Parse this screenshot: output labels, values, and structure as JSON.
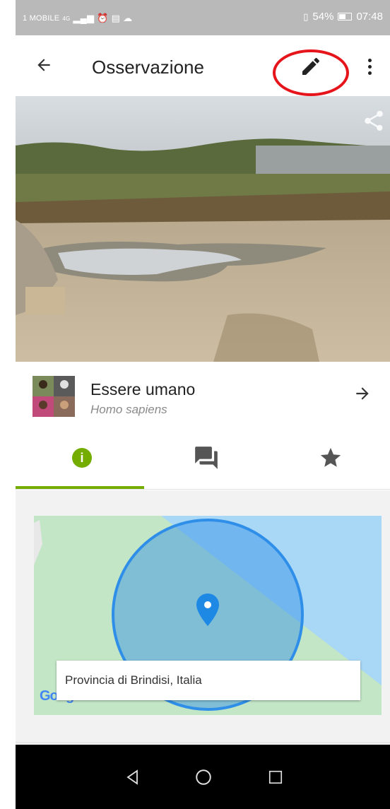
{
  "status_bar": {
    "carrier": "1 MOBILE",
    "network": "4G",
    "battery": "54%",
    "time": "07:48"
  },
  "app_bar": {
    "title": "Osservazione",
    "back_icon": "arrow-left-icon",
    "edit_icon": "pencil-icon",
    "menu_icon": "more-vert-icon"
  },
  "photo": {
    "share_icon": "share-icon"
  },
  "taxon": {
    "common_name": "Essere umano",
    "scientific_name": "Homo sapiens"
  },
  "tabs": [
    {
      "id": "info",
      "icon": "info-icon",
      "active": true
    },
    {
      "id": "comments",
      "icon": "comments-icon",
      "active": false
    },
    {
      "id": "favorites",
      "icon": "star-icon",
      "active": false
    }
  ],
  "map": {
    "place_label": "Provincia di Brindisi, Italia",
    "provider_logo": "Google"
  },
  "colors": {
    "accent": "#74ac00",
    "annotation": "#e6141b",
    "accuracy_circle": "#2f8fe8",
    "pin": "#1e88e5",
    "status_bar": "#b9b9b9",
    "nav_bar": "#000000"
  },
  "nav_bar": {
    "back_icon": "nav-back-icon",
    "home_icon": "nav-home-icon",
    "recents_icon": "nav-recents-icon"
  }
}
